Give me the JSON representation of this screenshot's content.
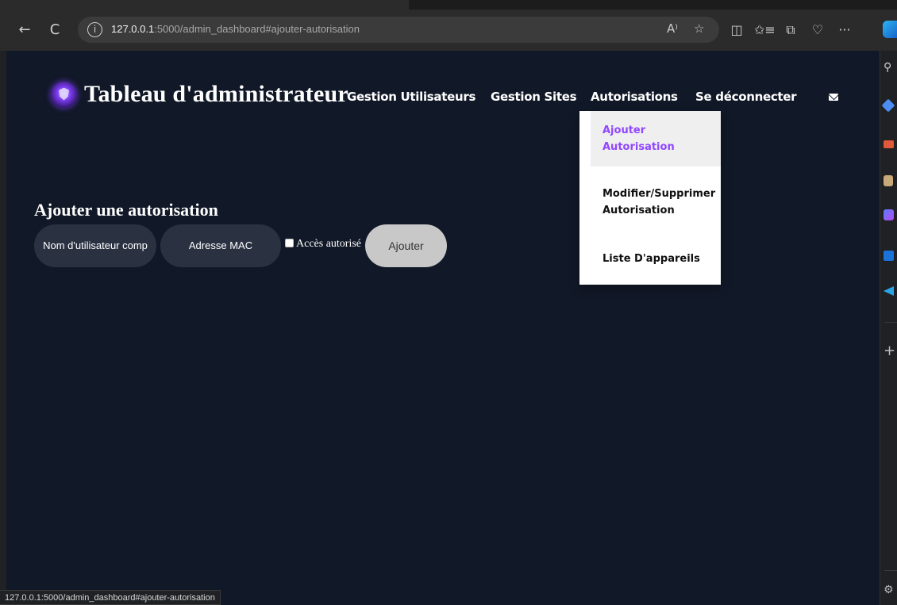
{
  "browser": {
    "back_icon": "←",
    "refresh_icon": "C",
    "info_icon": "i",
    "url_host": "127.0.0.1",
    "url_rest": ":5000/admin_dashboard#ajouter-autorisation",
    "read_aloud_icon": "A⁾",
    "favorite_icon": "☆",
    "split_icon": "◫",
    "favorites_bar_icon": "✩≡",
    "collections_icon": "⧉",
    "health_icon": "♡",
    "more_icon": "···"
  },
  "side_panel": {
    "search_icon": "⚲",
    "settings_icon": "⚙",
    "add_icon": "+"
  },
  "page": {
    "brand_title": "Tableau d'administrateur",
    "nav": {
      "users": "Gestion Utilisateurs",
      "sites": "Gestion Sites",
      "authorisations": "Autorisations",
      "logout": "Se déconnecter"
    },
    "dropdown": {
      "item1_line1": "Ajouter",
      "item1_line2": "Autorisation",
      "item2_line1": "Modifier/Supprimer",
      "item2_line2": "Autorisation",
      "item3": "Liste D'appareils"
    },
    "form": {
      "title": "Ajouter une autorisation",
      "username_placeholder": "Nom d'utilisateur comp",
      "mac_placeholder": "Adresse MAC",
      "access_label": "Accès autorisé",
      "submit_label": "Ajouter"
    }
  },
  "status_bar": {
    "url": "127.0.0.1:5000/admin_dashboard#ajouter-autorisation"
  }
}
